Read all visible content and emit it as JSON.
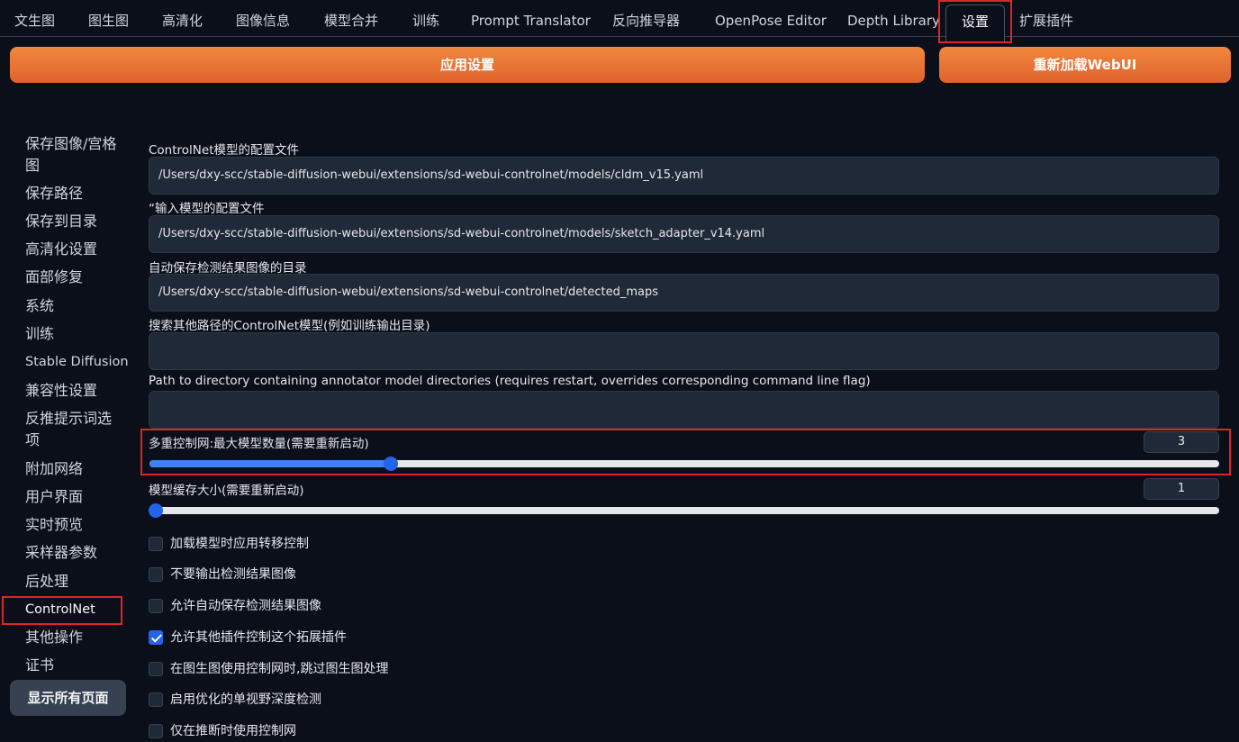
{
  "tabs": [
    {
      "label": "文生图"
    },
    {
      "label": "图生图"
    },
    {
      "label": "高清化"
    },
    {
      "label": "图像信息"
    },
    {
      "label": "模型合并"
    },
    {
      "label": "训练"
    },
    {
      "label": "Prompt Translator"
    },
    {
      "label": "反向推导器"
    },
    {
      "label": "OpenPose Editor"
    },
    {
      "label": "Depth Library"
    },
    {
      "label": "设置"
    },
    {
      "label": "扩展插件"
    }
  ],
  "buttons": {
    "apply": "应用设置",
    "reload": "重新加载WebUI",
    "show_all": "显示所有页面"
  },
  "sidebar": {
    "items": [
      {
        "label": "保存图像/宫格图"
      },
      {
        "label": "保存路径"
      },
      {
        "label": "保存到目录"
      },
      {
        "label": "高清化设置"
      },
      {
        "label": "面部修复"
      },
      {
        "label": "系统"
      },
      {
        "label": "训练"
      },
      {
        "label": "Stable Diffusion"
      },
      {
        "label": "兼容性设置"
      },
      {
        "label": "反推提示词选项"
      },
      {
        "label": "附加网络"
      },
      {
        "label": "用户界面"
      },
      {
        "label": "实时预览"
      },
      {
        "label": "采样器参数"
      },
      {
        "label": "后处理"
      },
      {
        "label": "ControlNet"
      },
      {
        "label": "其他操作"
      },
      {
        "label": "证书"
      }
    ]
  },
  "fields": [
    {
      "label": "ControlNet模型的配置文件",
      "value": "/Users/dxy-scc/stable-diffusion-webui/extensions/sd-webui-controlnet/models/cldm_v15.yaml"
    },
    {
      "label": "“输入模型的配置文件",
      "value": "/Users/dxy-scc/stable-diffusion-webui/extensions/sd-webui-controlnet/models/sketch_adapter_v14.yaml"
    },
    {
      "label": "自动保存检测结果图像的目录",
      "value": "/Users/dxy-scc/stable-diffusion-webui/extensions/sd-webui-controlnet/detected_maps"
    },
    {
      "label": "搜索其他路径的ControlNet模型(例如训练输出目录)",
      "value": ""
    },
    {
      "label": "Path to directory containing annotator model directories (requires restart, overrides corresponding command line flag)",
      "value": ""
    }
  ],
  "sliders": [
    {
      "label": "多重控制网:最大模型数量(需要重新启动)",
      "value": "3",
      "fill_fraction": 0.226
    },
    {
      "label": "模型缓存大小(需要重新启动)",
      "value": "1",
      "fill_fraction": 0.006
    }
  ],
  "checkboxes": [
    {
      "label": "加载模型时应用转移控制",
      "checked": false
    },
    {
      "label": "不要输出检测结果图像",
      "checked": false
    },
    {
      "label": "允许自动保存检测结果图像",
      "checked": false
    },
    {
      "label": "允许其他插件控制这个拓展插件",
      "checked": true
    },
    {
      "label": "在图生图使用控制网时,跳过图生图处理",
      "checked": false
    },
    {
      "label": "启用优化的单视野深度检测",
      "checked": false
    },
    {
      "label": "仅在推断时使用控制网",
      "checked": false
    }
  ],
  "colors": {
    "accent_orange": "#e8742f",
    "slider_blue": "#3b82f6",
    "highlight_red": "#dc2626",
    "background": "#0b0f19"
  }
}
